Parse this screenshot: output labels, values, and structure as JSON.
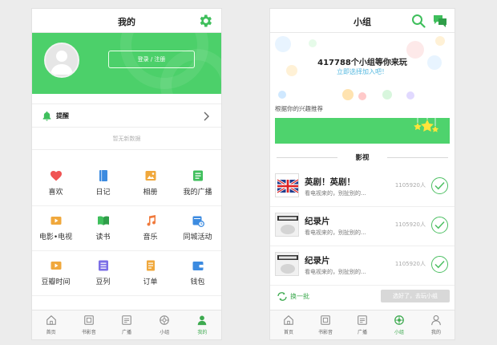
{
  "left": {
    "header_title": "我的",
    "login_label": "登录 / 注册",
    "reminder_label": "提醒",
    "empty_note": "暂无新数据",
    "grid": [
      {
        "label": "喜欢",
        "icon": "heart-icon",
        "color": "#f05454"
      },
      {
        "label": "日记",
        "icon": "notebook-icon",
        "color": "#3c8be0"
      },
      {
        "label": "相册",
        "icon": "album-icon",
        "color": "#f0a83c"
      },
      {
        "label": "我的广播",
        "icon": "broadcast-list-icon",
        "color": "#3fbf5c"
      },
      {
        "label": "电影•电视",
        "icon": "film-icon",
        "color": "#f0a83c"
      },
      {
        "label": "读书",
        "icon": "book-icon",
        "color": "#3fbf5c"
      },
      {
        "label": "音乐",
        "icon": "music-note-icon",
        "color": "#f07a3c"
      },
      {
        "label": "同城活动",
        "icon": "calendar-icon",
        "color": "#3c8be0"
      },
      {
        "label": "豆瓣时间",
        "icon": "play-box-icon",
        "color": "#f0a83c"
      },
      {
        "label": "豆列",
        "icon": "list-icon",
        "color": "#7b6ee6"
      },
      {
        "label": "订单",
        "icon": "order-icon",
        "color": "#f0a83c"
      },
      {
        "label": "钱包",
        "icon": "wallet-icon",
        "color": "#3c8be0"
      }
    ],
    "tabs": [
      {
        "label": "首页",
        "icon": "home-icon"
      },
      {
        "label": "书影音",
        "icon": "media-icon"
      },
      {
        "label": "广播",
        "icon": "broadcast-icon"
      },
      {
        "label": "小组",
        "icon": "group-icon"
      },
      {
        "label": "我的",
        "icon": "person-icon",
        "active": true
      }
    ]
  },
  "right": {
    "header_title": "小组",
    "hero_title": "417788个小组等你来玩",
    "hero_subtitle": "立即选择加入吧！",
    "rec_label": "根据你的兴趣推荐",
    "section_title": "影视",
    "groups": [
      {
        "name": "英剧！英剧！",
        "desc": "看电视来的，别扯别的...",
        "count": "1105920人",
        "thumb": "union-jack"
      },
      {
        "name": "纪录片",
        "desc": "看电视来的，别扯别的...",
        "count": "1105920人",
        "thumb": "documentary"
      },
      {
        "name": "纪录片",
        "desc": "看电视来的，别扯别的...",
        "count": "1105920人",
        "thumb": "documentary"
      }
    ],
    "refresh_label": "换一批",
    "skip_label": "选好了，去玩小组",
    "tabs": [
      {
        "label": "首页",
        "icon": "home-icon"
      },
      {
        "label": "书影音",
        "icon": "media-icon"
      },
      {
        "label": "广播",
        "icon": "broadcast-icon"
      },
      {
        "label": "小组",
        "icon": "group-icon",
        "active": true
      },
      {
        "label": "我的",
        "icon": "person-icon"
      }
    ]
  },
  "colors": {
    "accent": "#4cd06a",
    "active_tab": "#3daa4f",
    "hero_sub": "#56b9e0"
  }
}
